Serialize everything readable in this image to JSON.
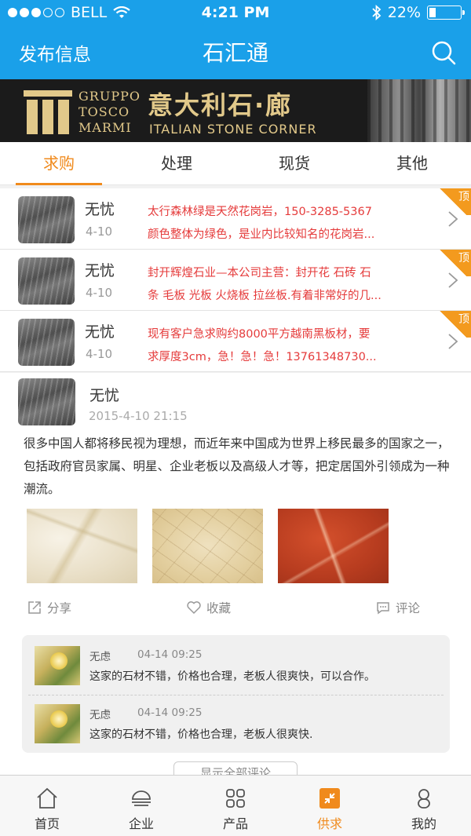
{
  "status_bar": {
    "carrier": "BELL",
    "time": "4:21 PM",
    "battery": "22%",
    "battery_level": 0.22
  },
  "nav": {
    "left_label": "发布信息",
    "title": "石汇通"
  },
  "banner": {
    "brand_line1": "GRUPPO",
    "brand_line2": "TOSCO",
    "brand_line3": "MARMI",
    "title_cn": "意大利石·廊",
    "title_en": "ITALIAN STONE CORNER"
  },
  "tabs": [
    {
      "label": "求购",
      "active": true
    },
    {
      "label": "处理",
      "active": false
    },
    {
      "label": "现货",
      "active": false
    },
    {
      "label": "其他",
      "active": false
    }
  ],
  "list": [
    {
      "name": "无忧",
      "date": "4-10",
      "line1": "太行森林绿是天然花岗岩，150-3285-5367",
      "line2": "颜色整体为绿色，是业内比较知名的花岗岩...",
      "badge": "顶"
    },
    {
      "name": "无忧",
      "date": "4-10",
      "line1": "封开辉煌石业—本公司主营：封开花 石砖 石",
      "line2": "条 毛板 光板 火烧板 拉丝板.有着非常好的几...",
      "badge": "顶"
    },
    {
      "name": "无忧",
      "date": "4-10",
      "line1": "现有客户急求购约8000平方越南黑板材，要",
      "line2": "求厚度3cm，急！急！急！13761348730...",
      "badge": "顶"
    }
  ],
  "post": {
    "name": "无忧",
    "date": "2015-4-10 21:15",
    "body": "很多中国人都将移民视为理想，而近年来中国成为世界上移民最多的国家之一，包括政府官员家属、明星、企业老板以及高级人才等，把定居国外引领成为一种潮流。",
    "actions": {
      "share": "分享",
      "favorite": "收藏",
      "comment": "评论"
    },
    "comments": [
      {
        "name": "无虑",
        "time": "04-14 09:25",
        "text": "这家的石材不错，价格也合理，老板人很爽快，可以合作。"
      },
      {
        "name": "无虑",
        "time": "04-14 09:25",
        "text": "这家的石材不错，价格也合理，老板人很爽快."
      }
    ],
    "show_all": "显示全部评论"
  },
  "tabbar": [
    {
      "label": "首页",
      "icon": "home-icon",
      "active": false
    },
    {
      "label": "企业",
      "icon": "enterprise-icon",
      "active": false
    },
    {
      "label": "产品",
      "icon": "products-icon",
      "active": false
    },
    {
      "label": "供求",
      "icon": "supply-demand-icon",
      "active": true
    },
    {
      "label": "我的",
      "icon": "profile-icon",
      "active": false
    }
  ],
  "colors": {
    "primary": "#1aa0e9",
    "accent": "#f08a1c",
    "alert_text": "#e53b3b"
  }
}
